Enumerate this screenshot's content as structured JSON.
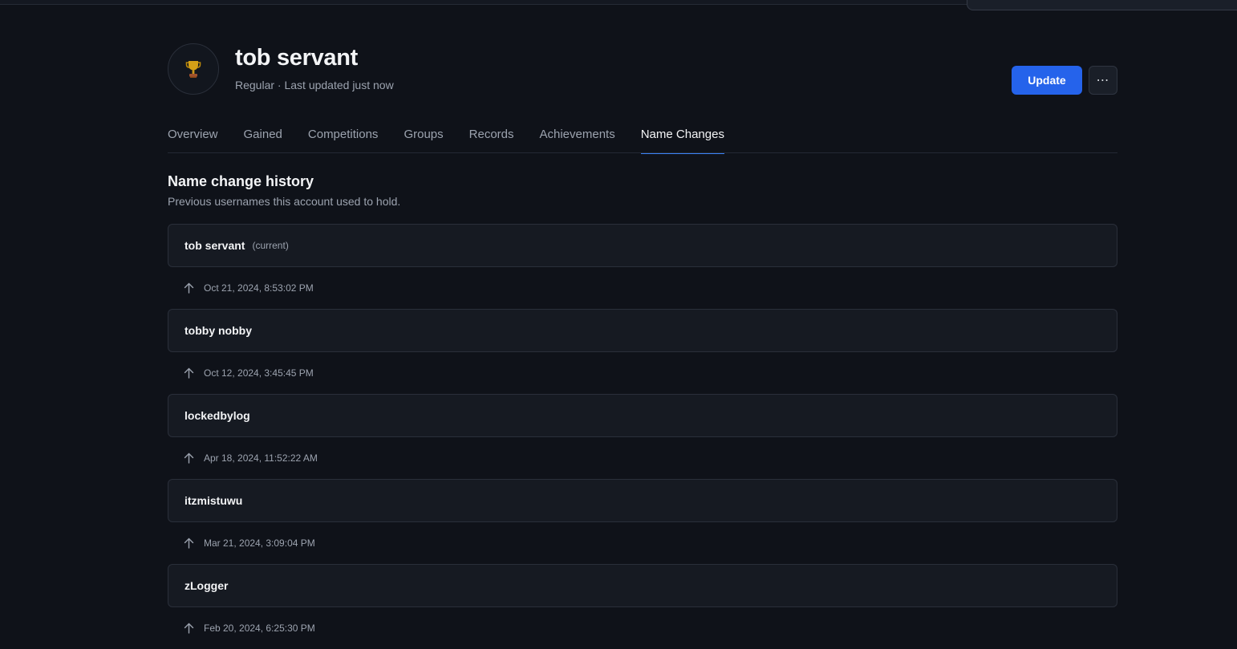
{
  "player": {
    "name": "tob servant",
    "subtitle": "Regular · Last updated just now",
    "avatar_icon": "trophy-icon"
  },
  "actions": {
    "update_label": "Update",
    "more_label": "⋯"
  },
  "tabs": [
    {
      "label": "Overview",
      "active": false
    },
    {
      "label": "Gained",
      "active": false
    },
    {
      "label": "Competitions",
      "active": false
    },
    {
      "label": "Groups",
      "active": false
    },
    {
      "label": "Records",
      "active": false
    },
    {
      "label": "Achievements",
      "active": false
    },
    {
      "label": "Name Changes",
      "active": true
    }
  ],
  "section": {
    "title": "Name change history",
    "description": "Previous usernames this account used to hold."
  },
  "history": [
    {
      "name": "tob servant",
      "tag": "(current)",
      "changed_at": "Oct 21, 2024, 8:53:02 PM"
    },
    {
      "name": "tobby nobby",
      "tag": "",
      "changed_at": "Oct 12, 2024, 3:45:45 PM"
    },
    {
      "name": "lockedbylog",
      "tag": "",
      "changed_at": "Apr 18, 2024, 11:52:22 AM"
    },
    {
      "name": "itzmistuwu",
      "tag": "",
      "changed_at": "Mar 21, 2024, 3:09:04 PM"
    },
    {
      "name": "zLogger",
      "tag": "",
      "changed_at": "Feb 20, 2024, 6:25:30 PM"
    }
  ],
  "colors": {
    "background": "#0f1219",
    "card": "#161a22",
    "accent": "#2563eb",
    "tab_indicator": "#3b82f6",
    "muted_text": "#9ca3af"
  }
}
